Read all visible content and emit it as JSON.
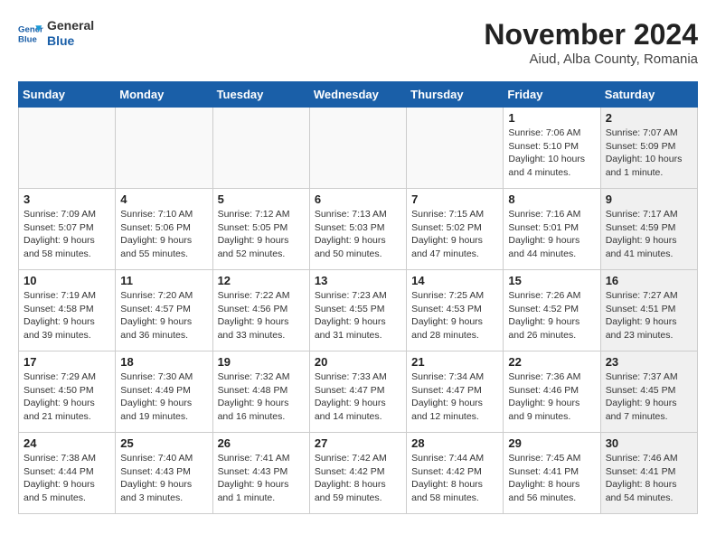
{
  "header": {
    "logo_line1": "General",
    "logo_line2": "Blue",
    "month": "November 2024",
    "location": "Aiud, Alba County, Romania"
  },
  "weekdays": [
    "Sunday",
    "Monday",
    "Tuesday",
    "Wednesday",
    "Thursday",
    "Friday",
    "Saturday"
  ],
  "weeks": [
    [
      {
        "day": "",
        "text": "",
        "shade": "empty"
      },
      {
        "day": "",
        "text": "",
        "shade": "empty"
      },
      {
        "day": "",
        "text": "",
        "shade": "empty"
      },
      {
        "day": "",
        "text": "",
        "shade": "empty"
      },
      {
        "day": "",
        "text": "",
        "shade": "empty"
      },
      {
        "day": "1",
        "text": "Sunrise: 7:06 AM\nSunset: 5:10 PM\nDaylight: 10 hours\nand 4 minutes.",
        "shade": "normal"
      },
      {
        "day": "2",
        "text": "Sunrise: 7:07 AM\nSunset: 5:09 PM\nDaylight: 10 hours\nand 1 minute.",
        "shade": "shaded"
      }
    ],
    [
      {
        "day": "3",
        "text": "Sunrise: 7:09 AM\nSunset: 5:07 PM\nDaylight: 9 hours\nand 58 minutes.",
        "shade": "normal"
      },
      {
        "day": "4",
        "text": "Sunrise: 7:10 AM\nSunset: 5:06 PM\nDaylight: 9 hours\nand 55 minutes.",
        "shade": "normal"
      },
      {
        "day": "5",
        "text": "Sunrise: 7:12 AM\nSunset: 5:05 PM\nDaylight: 9 hours\nand 52 minutes.",
        "shade": "normal"
      },
      {
        "day": "6",
        "text": "Sunrise: 7:13 AM\nSunset: 5:03 PM\nDaylight: 9 hours\nand 50 minutes.",
        "shade": "normal"
      },
      {
        "day": "7",
        "text": "Sunrise: 7:15 AM\nSunset: 5:02 PM\nDaylight: 9 hours\nand 47 minutes.",
        "shade": "normal"
      },
      {
        "day": "8",
        "text": "Sunrise: 7:16 AM\nSunset: 5:01 PM\nDaylight: 9 hours\nand 44 minutes.",
        "shade": "normal"
      },
      {
        "day": "9",
        "text": "Sunrise: 7:17 AM\nSunset: 4:59 PM\nDaylight: 9 hours\nand 41 minutes.",
        "shade": "shaded"
      }
    ],
    [
      {
        "day": "10",
        "text": "Sunrise: 7:19 AM\nSunset: 4:58 PM\nDaylight: 9 hours\nand 39 minutes.",
        "shade": "normal"
      },
      {
        "day": "11",
        "text": "Sunrise: 7:20 AM\nSunset: 4:57 PM\nDaylight: 9 hours\nand 36 minutes.",
        "shade": "normal"
      },
      {
        "day": "12",
        "text": "Sunrise: 7:22 AM\nSunset: 4:56 PM\nDaylight: 9 hours\nand 33 minutes.",
        "shade": "normal"
      },
      {
        "day": "13",
        "text": "Sunrise: 7:23 AM\nSunset: 4:55 PM\nDaylight: 9 hours\nand 31 minutes.",
        "shade": "normal"
      },
      {
        "day": "14",
        "text": "Sunrise: 7:25 AM\nSunset: 4:53 PM\nDaylight: 9 hours\nand 28 minutes.",
        "shade": "normal"
      },
      {
        "day": "15",
        "text": "Sunrise: 7:26 AM\nSunset: 4:52 PM\nDaylight: 9 hours\nand 26 minutes.",
        "shade": "normal"
      },
      {
        "day": "16",
        "text": "Sunrise: 7:27 AM\nSunset: 4:51 PM\nDaylight: 9 hours\nand 23 minutes.",
        "shade": "shaded"
      }
    ],
    [
      {
        "day": "17",
        "text": "Sunrise: 7:29 AM\nSunset: 4:50 PM\nDaylight: 9 hours\nand 21 minutes.",
        "shade": "normal"
      },
      {
        "day": "18",
        "text": "Sunrise: 7:30 AM\nSunset: 4:49 PM\nDaylight: 9 hours\nand 19 minutes.",
        "shade": "normal"
      },
      {
        "day": "19",
        "text": "Sunrise: 7:32 AM\nSunset: 4:48 PM\nDaylight: 9 hours\nand 16 minutes.",
        "shade": "normal"
      },
      {
        "day": "20",
        "text": "Sunrise: 7:33 AM\nSunset: 4:47 PM\nDaylight: 9 hours\nand 14 minutes.",
        "shade": "normal"
      },
      {
        "day": "21",
        "text": "Sunrise: 7:34 AM\nSunset: 4:47 PM\nDaylight: 9 hours\nand 12 minutes.",
        "shade": "normal"
      },
      {
        "day": "22",
        "text": "Sunrise: 7:36 AM\nSunset: 4:46 PM\nDaylight: 9 hours\nand 9 minutes.",
        "shade": "normal"
      },
      {
        "day": "23",
        "text": "Sunrise: 7:37 AM\nSunset: 4:45 PM\nDaylight: 9 hours\nand 7 minutes.",
        "shade": "shaded"
      }
    ],
    [
      {
        "day": "24",
        "text": "Sunrise: 7:38 AM\nSunset: 4:44 PM\nDaylight: 9 hours\nand 5 minutes.",
        "shade": "normal"
      },
      {
        "day": "25",
        "text": "Sunrise: 7:40 AM\nSunset: 4:43 PM\nDaylight: 9 hours\nand 3 minutes.",
        "shade": "normal"
      },
      {
        "day": "26",
        "text": "Sunrise: 7:41 AM\nSunset: 4:43 PM\nDaylight: 9 hours\nand 1 minute.",
        "shade": "normal"
      },
      {
        "day": "27",
        "text": "Sunrise: 7:42 AM\nSunset: 4:42 PM\nDaylight: 8 hours\nand 59 minutes.",
        "shade": "normal"
      },
      {
        "day": "28",
        "text": "Sunrise: 7:44 AM\nSunset: 4:42 PM\nDaylight: 8 hours\nand 58 minutes.",
        "shade": "normal"
      },
      {
        "day": "29",
        "text": "Sunrise: 7:45 AM\nSunset: 4:41 PM\nDaylight: 8 hours\nand 56 minutes.",
        "shade": "normal"
      },
      {
        "day": "30",
        "text": "Sunrise: 7:46 AM\nSunset: 4:41 PM\nDaylight: 8 hours\nand 54 minutes.",
        "shade": "shaded"
      }
    ]
  ]
}
